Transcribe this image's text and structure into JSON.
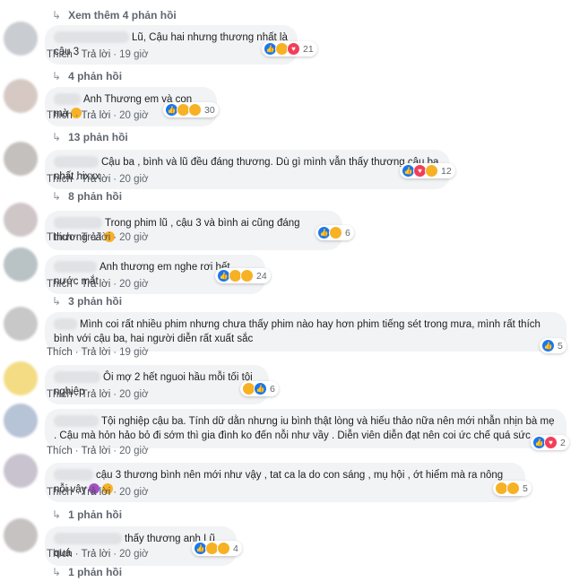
{
  "toggles": [
    {
      "text": "Xem thêm 4 phản hồi"
    },
    {
      "text": "4 phản hồi"
    },
    {
      "text": "13 phản hồi"
    },
    {
      "text": "8 phản hồi"
    },
    {
      "text": "3 phản hồi"
    },
    {
      "text": "1 phản hồi"
    },
    {
      "text": "1 phản hồi"
    }
  ],
  "actions": {
    "like": "Thích",
    "reply": "Trả lời",
    "sep": "·"
  },
  "comments": [
    {
      "text": "Lũ, Cậu hai nhưng thương nhất là cậu 3",
      "time": "19 giờ",
      "count": "21"
    },
    {
      "text": "Anh Thương em và con mà",
      "time": "20 giờ",
      "count": "30"
    },
    {
      "text": "Cậu ba , bình và lũ đều đáng thương. Dù gì mình vẫn thấy thương cậu ba nhất hixxx",
      "time": "20 giờ",
      "count": "12"
    },
    {
      "text": "Trong phim lũ , cậu 3 và bình ai cũng đáng thương cả",
      "time": "20 giờ",
      "count": "6"
    },
    {
      "text": "Anh thương em nghe rơi hết nước mắt",
      "time": "20 giờ",
      "count": "24"
    },
    {
      "text": "Mình coi rất nhiều phim nhưng chưa thấy phim nào hay hơn phim tiếng sét trong mưa, mình rất thích bình với cậu ba, hai người diễn rất xuất sắc",
      "time": "19 giờ",
      "count": "5"
    },
    {
      "text": "Ôi mợ 2 hết nguoi hầu mỗi tối tội nghiệp",
      "time": "20 giờ",
      "count": "6"
    },
    {
      "text": "Tội nghiệp cậu ba. Tính dữ dằn nhưng iu bình thật lòng và hiếu thảo nữa nên mới nhẫn nhịn bà mẹ . Cậu mà hỏn hảo bỏ đi sớm thì gia đình ko đến nỗi như vầy . Diễn viên diễn đạt nên coi ức chế quá sức .",
      "time": "20 giờ",
      "count": "2"
    },
    {
      "text": "cậu 3 thương bình nên mới như vậy , tat ca la do con sáng , mụ hội , ớt hiểm mà ra nông nỗi vậy",
      "time": "20 giờ",
      "count": "5"
    },
    {
      "text": "thấy thương anh Lũ quá",
      "time": "20 giờ",
      "count": "4"
    }
  ],
  "colors": {
    "bubble": "#f2f3f5",
    "meta": "#606770",
    "like": "#1877f2",
    "love": "#f33e58",
    "haha": "#f7b125"
  }
}
